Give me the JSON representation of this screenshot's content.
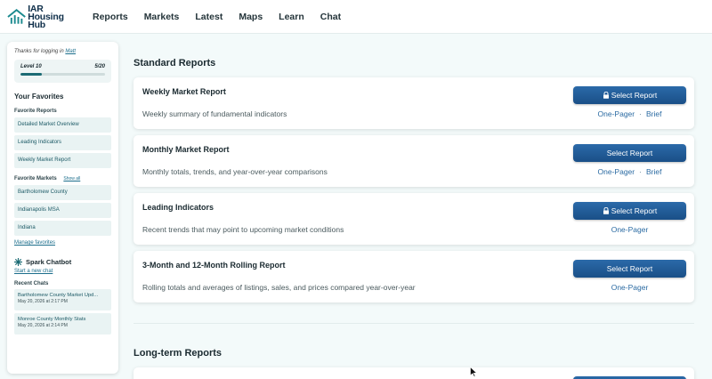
{
  "nav": {
    "logo_line1": "IAR",
    "logo_line2": "Housing Hub",
    "items": [
      "Reports",
      "Markets",
      "Latest",
      "Maps",
      "Learn",
      "Chat"
    ]
  },
  "sidebar": {
    "thanks_prefix": "Thanks for logging in",
    "user": "Matt",
    "level_label": "Level 10",
    "level_progress": "5/20",
    "level_fraction": 0.25,
    "favorites_title": "Your Favorites",
    "favorite_reports_label": "Favorite Reports",
    "favorite_reports": [
      "Detailed Market Overview",
      "Leading Indicators",
      "Weekly Market Report"
    ],
    "favorite_markets_label": "Favorite Markets",
    "show_all": "Show all",
    "favorite_markets": [
      "Bartholomew County",
      "Indianapolis MSA",
      "Indiana"
    ],
    "manage_favorites": "Manage favorites",
    "chatbot_title": "Spark Chatbot",
    "new_chat": "Start a new chat",
    "recent_chats_label": "Recent Chats",
    "recent_chats": [
      {
        "title": "Bartholomew County Market Upd...",
        "date": "May 20, 2026 at 2:17 PM"
      },
      {
        "title": "Monroe County Monthly Stats",
        "date": "May 20, 2026 at 2:14 PM"
      }
    ]
  },
  "main": {
    "standard_title": "Standard Reports",
    "longterm_title": "Long-term Reports",
    "reports": [
      {
        "title": "Weekly Market Report",
        "desc": "Weekly summary of fundamental indicators",
        "button": "Select Report",
        "locked": true,
        "formats": [
          "One-Pager",
          "Brief"
        ]
      },
      {
        "title": "Monthly Market Report",
        "desc": "Monthly totals, trends, and year-over-year comparisons",
        "button": "Select Report",
        "locked": false,
        "formats": [
          "One-Pager",
          "Brief"
        ]
      },
      {
        "title": "Leading Indicators",
        "desc": "Recent trends that may point to upcoming market conditions",
        "button": "Select Report",
        "locked": true,
        "formats": [
          "One-Pager"
        ]
      },
      {
        "title": "3-Month and 12-Month Rolling Report",
        "desc": "Rolling totals and averages of listings, sales, and prices compared year-over-year",
        "button": "Select Report",
        "locked": false,
        "formats": [
          "One-Pager"
        ]
      }
    ],
    "format_separator": "·"
  },
  "colors": {
    "accent": "#1b6b74",
    "button": "#1f5a95",
    "link": "#2a6aa2"
  }
}
